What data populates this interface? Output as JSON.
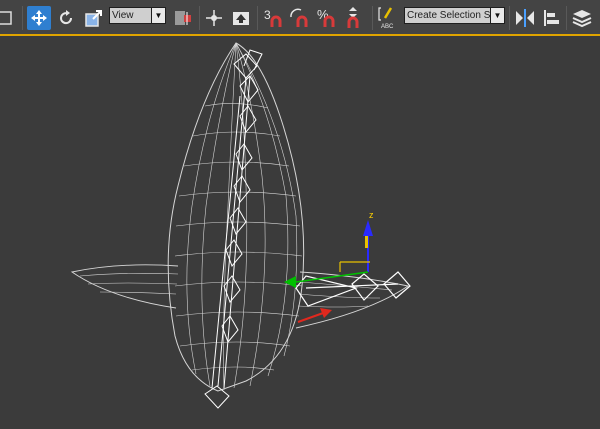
{
  "toolbar": {
    "reference_coord_value": "View",
    "snaps_label": "3",
    "percent_snap_label": "%",
    "named_selection_placeholder": "Create Selection Se",
    "edit_named_sel_label": "ABC"
  },
  "icons": [
    "select-region-icon",
    "select-move-icon",
    "select-rotate-icon",
    "select-scale-icon",
    "pivot-center-icon",
    "select-manipulate-icon",
    "keyboard-shortcut-icon",
    "snaps-toggle-icon",
    "angle-snap-icon",
    "percent-snap-icon",
    "spinner-snap-icon",
    "edit-named-selection-icon",
    "mirror-icon",
    "align-icon",
    "layer-explorer-icon"
  ],
  "viewport": {
    "gizmo_z_label": "z",
    "colors": {
      "wireframe": "#dcdcdc",
      "bones": "#ffffff",
      "gizmo_x": "#e8c000",
      "gizmo_y": "#00c000",
      "gizmo_z": "#2a2aff",
      "arrow": "#e0281e"
    }
  }
}
